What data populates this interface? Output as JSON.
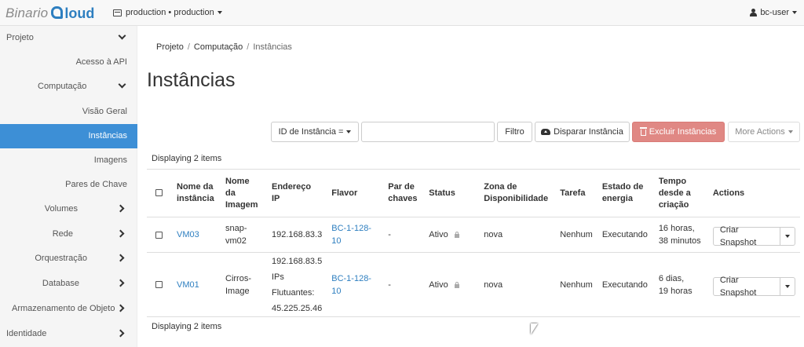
{
  "brand": {
    "part1": "Binario",
    "part2": "loud"
  },
  "project_selector": {
    "label": "production • production"
  },
  "user_menu": {
    "label": "bc-user"
  },
  "sidebar": {
    "items": [
      {
        "label": "Projeto"
      },
      {
        "label": "Acesso à API"
      },
      {
        "label": "Computação"
      },
      {
        "label": "Visão Geral"
      },
      {
        "label": "Instâncias"
      },
      {
        "label": "Imagens"
      },
      {
        "label": "Pares de Chave"
      },
      {
        "label": "Volumes"
      },
      {
        "label": "Rede"
      },
      {
        "label": "Orquestração"
      },
      {
        "label": "Database"
      },
      {
        "label": "Armazenamento de Objeto"
      },
      {
        "label": "Identidade"
      }
    ]
  },
  "breadcrumb": {
    "items": [
      "Projeto",
      "Computação",
      "Instâncias"
    ]
  },
  "page_title": "Instâncias",
  "toolbar": {
    "filter_select": "ID de Instância =",
    "filter_input_value": "",
    "filter_button": "Filtro",
    "launch_button": "Disparar Instância",
    "delete_button": "Excluir Instâncias",
    "more_actions": "More Actions"
  },
  "displaying_top": "Displaying 2 items",
  "displaying_bottom": "Displaying 2 items",
  "table": {
    "headers": {
      "name": [
        "Nome da",
        "instância"
      ],
      "image": [
        "Nome",
        "da",
        "Imagem"
      ],
      "ip": [
        "Endereço",
        "IP"
      ],
      "flavor": [
        "Flavor"
      ],
      "keypair": [
        "Par de",
        "chaves"
      ],
      "status": [
        "Status"
      ],
      "az": [
        "Zona de",
        "Disponibilidade"
      ],
      "task": [
        "Tarefa"
      ],
      "power": [
        "Estado de",
        "energia"
      ],
      "age": [
        "Tempo",
        "desde a",
        "criação"
      ],
      "actions": [
        "Actions"
      ]
    },
    "rows": [
      {
        "name": "VM03",
        "image": [
          "snap-",
          "vm02"
        ],
        "ip": [
          "192.168.83.3"
        ],
        "flavor": "BC-1-128-10",
        "keypair": "-",
        "status": "Ativo",
        "az": "nova",
        "task": "Nenhum",
        "power": "Executando",
        "age": [
          "16 horas,",
          "38 minutos"
        ],
        "action": "Criar Snapshot"
      },
      {
        "name": "VM01",
        "image": [
          "Cirros-",
          "Image"
        ],
        "ip": [
          "192.168.83.5",
          "IPs",
          "Flutuantes:",
          "45.225.25.46"
        ],
        "flavor": "BC-1-128-10",
        "keypair": "-",
        "status": "Ativo",
        "az": "nova",
        "task": "Nenhum",
        "power": "Executando",
        "age": [
          "6 dias,",
          "19 horas"
        ],
        "action": "Criar Snapshot"
      }
    ]
  },
  "colors": {
    "accent": "#3d8fd6",
    "link": "#2e7fc0",
    "danger": "#e08884"
  },
  "icons": {
    "project": "project-icon",
    "user": "user-icon",
    "launch": "cloud-upload-icon",
    "delete": "trash-icon",
    "locked": "lock-icon"
  }
}
